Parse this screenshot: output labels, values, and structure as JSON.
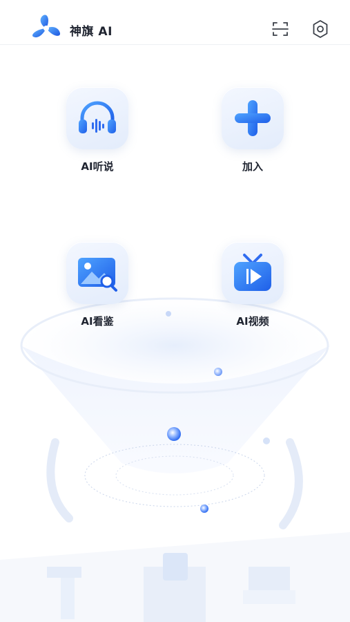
{
  "app": {
    "title": "神旗 AI"
  },
  "header": {
    "scan_icon": "scan-icon",
    "settings_icon": "gear-icon"
  },
  "tiles": [
    {
      "label": "AI听说",
      "icon": "headphones-icon"
    },
    {
      "label": "加入",
      "icon": "plus-icon"
    },
    {
      "label": "AI看鉴",
      "icon": "image-search-icon"
    },
    {
      "label": "AI视频",
      "icon": "tv-play-icon"
    }
  ],
  "colors": {
    "accent": "#2f6cf0",
    "accent_light": "#5aa0ff",
    "tile_bg": "#eaf1fc"
  }
}
